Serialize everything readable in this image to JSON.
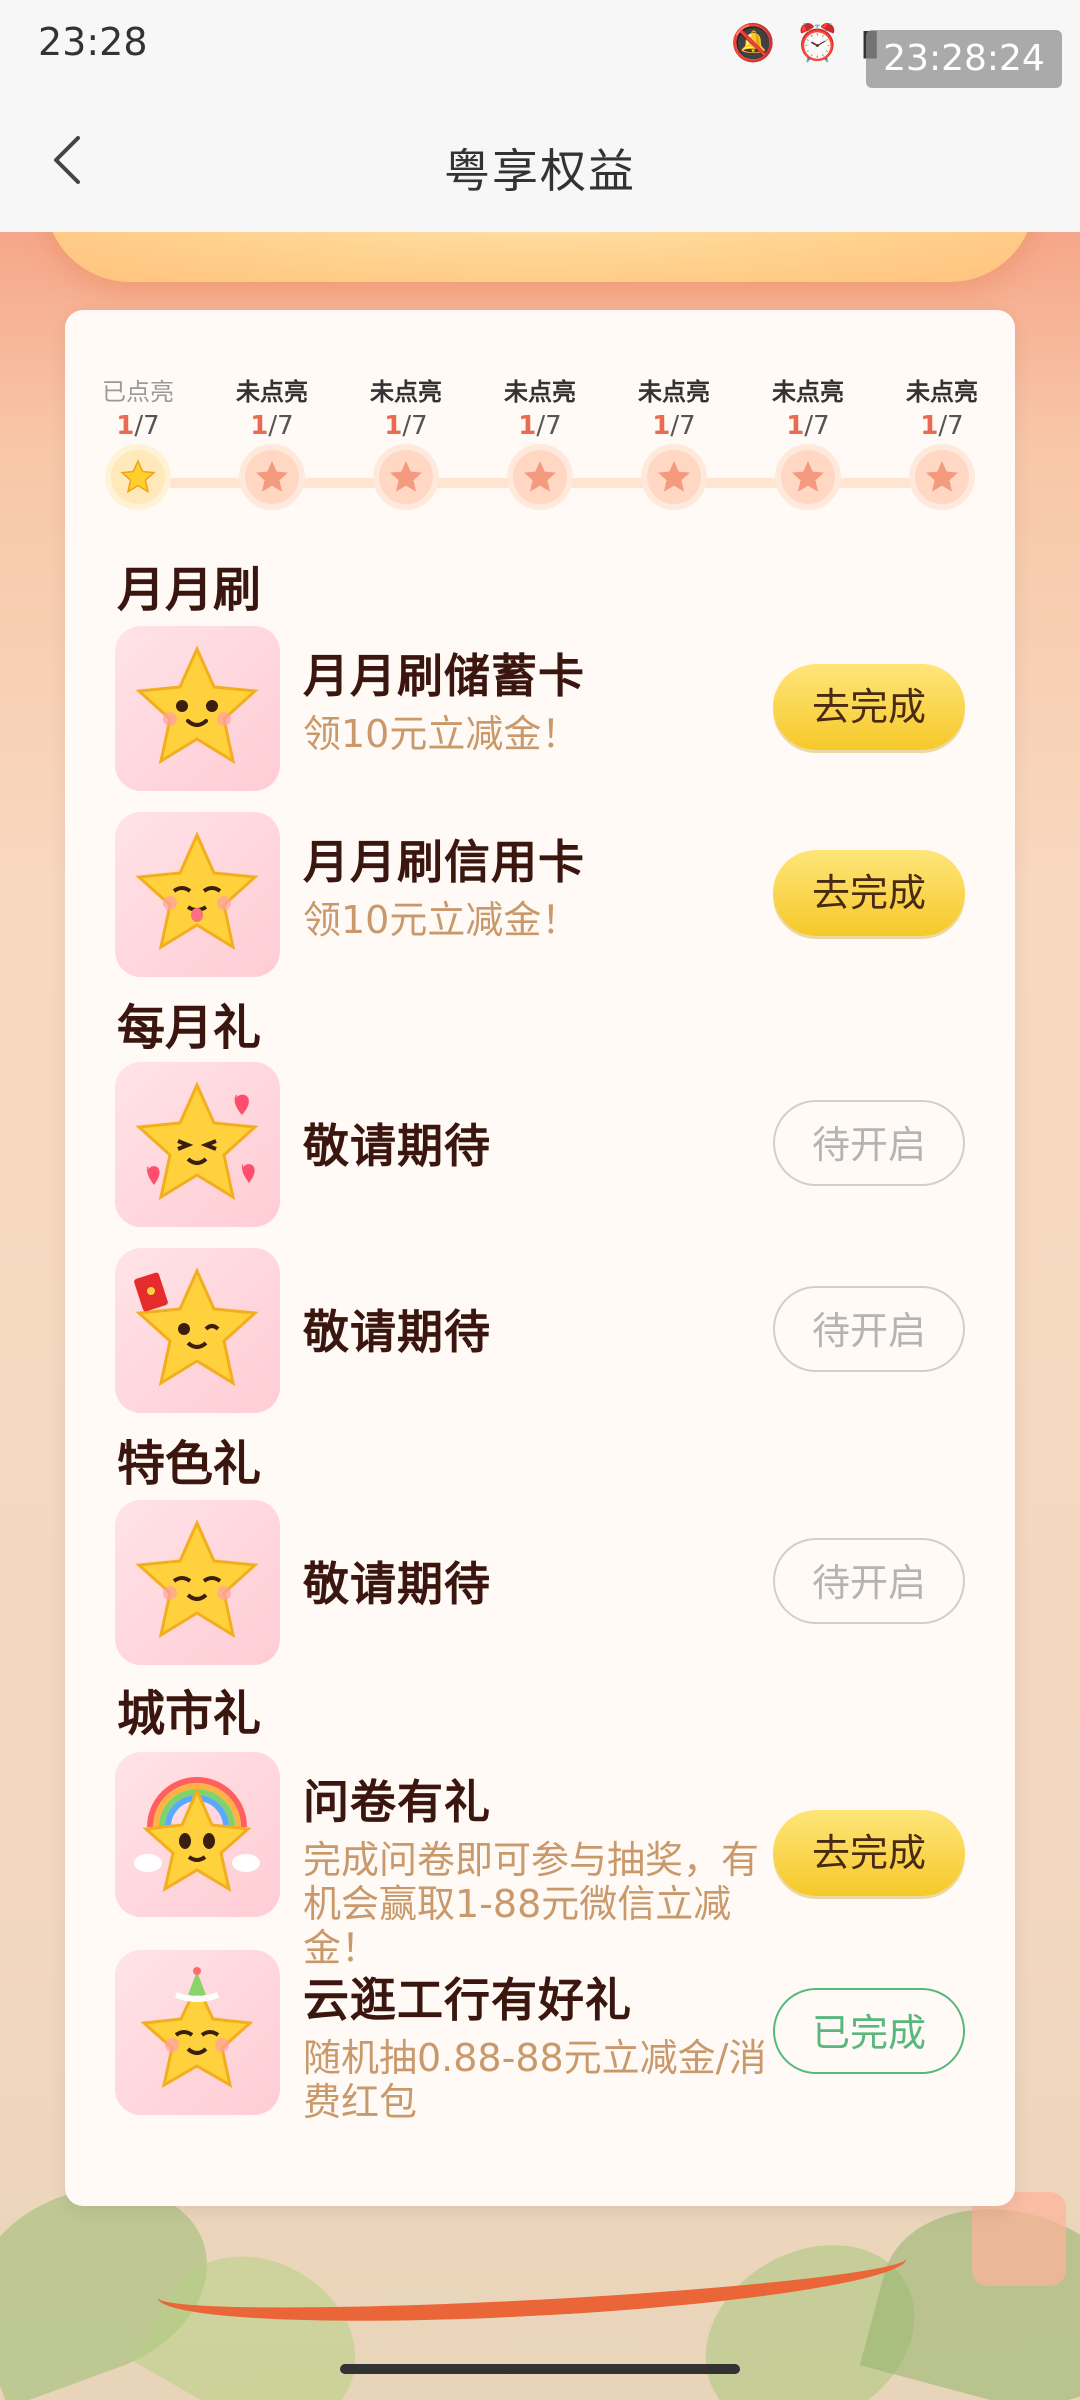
{
  "status": {
    "time": "23:28",
    "overlay_time": "23:28:24"
  },
  "header": {
    "title": "粤享权益"
  },
  "progress": {
    "steps": [
      {
        "label": "已点亮",
        "current": "1",
        "total": "/7",
        "lit": true
      },
      {
        "label": "未点亮",
        "current": "1",
        "total": "/7",
        "lit": false
      },
      {
        "label": "未点亮",
        "current": "1",
        "total": "/7",
        "lit": false
      },
      {
        "label": "未点亮",
        "current": "1",
        "total": "/7",
        "lit": false
      },
      {
        "label": "未点亮",
        "current": "1",
        "total": "/7",
        "lit": false
      },
      {
        "label": "未点亮",
        "current": "1",
        "total": "/7",
        "lit": false
      },
      {
        "label": "未点亮",
        "current": "1",
        "total": "/7",
        "lit": false
      }
    ]
  },
  "sections": {
    "monthly_swipe": {
      "title": "月月刷",
      "items": [
        {
          "title": "月月刷储蓄卡",
          "subtitle": "领10元立减金！",
          "button": "去完成"
        },
        {
          "title": "月月刷信用卡",
          "subtitle": "领10元立减金！",
          "button": "去完成"
        }
      ]
    },
    "monthly_gift": {
      "title": "每月礼",
      "items": [
        {
          "title": "敬请期待",
          "button": "待开启"
        },
        {
          "title": "敬请期待",
          "button": "待开启"
        }
      ]
    },
    "special_gift": {
      "title": "特色礼",
      "items": [
        {
          "title": "敬请期待",
          "button": "待开启"
        }
      ]
    },
    "city_gift": {
      "title": "城市礼",
      "items": [
        {
          "title": "问卷有礼",
          "subtitle": "完成问卷即可参与抽奖，有机会赢取1-88元微信立减金！",
          "button": "去完成"
        },
        {
          "title": "云逛工行有好礼",
          "subtitle": "随机抽0.88-88元立减金/消费红包",
          "button": "已完成"
        }
      ]
    }
  },
  "colors": {
    "accent_yellow": "#f6c92a",
    "done_green": "#59b77d",
    "title_brown": "#3b160f",
    "subtitle_tan": "#c9996b"
  }
}
